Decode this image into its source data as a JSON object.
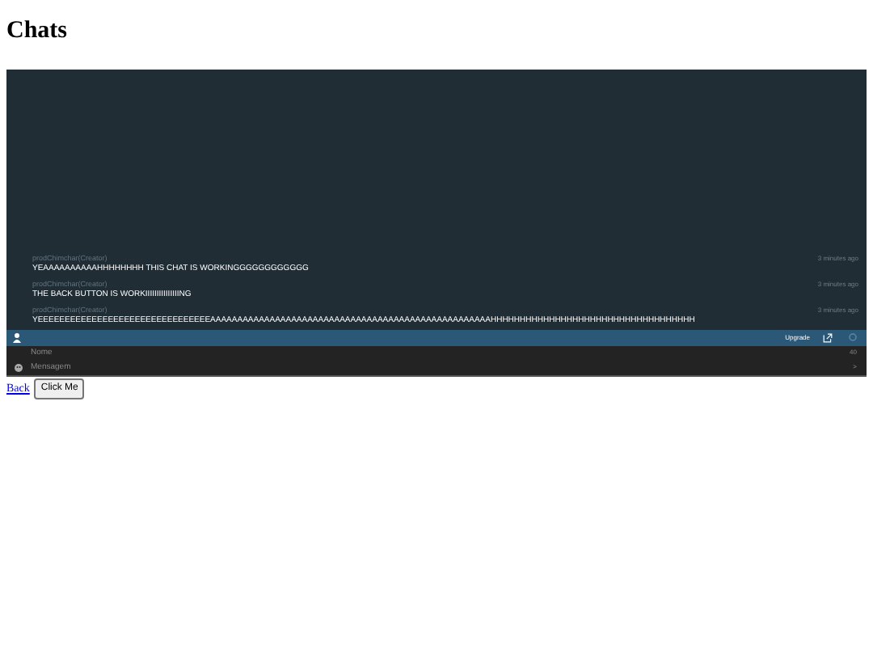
{
  "title": "Chats",
  "messages": [
    {
      "author": "prodChimchar(Creator)",
      "text": "YEAAAAAAAAAAHHHHHHHH THIS CHAT IS WORKINGGGGGGGGGGGG",
      "time": "3 minutes ago"
    },
    {
      "author": "prodChimchar(Creator)",
      "text": "THE BACK BUTTON IS WORKIIIIIIIIIIIIIIING",
      "time": "3 minutes ago"
    },
    {
      "author": "prodChimchar(Creator)",
      "text": "YEEEEEEEEEEEEEEEEEEEEEEEEEEEEEEEEAAAAAAAAAAAAAAAAAAAAAAAAAAAAAAAAAAAAAAAAAAAAAAAAAAAAHHHHHHHHHHHHHHHHHHHHHHHHHHHHHHHHHHH",
      "time": "3 minutes ago"
    }
  ],
  "toolbar": {
    "upgrade": "Upgrade"
  },
  "name_field": {
    "placeholder": "Nome",
    "counter": "40"
  },
  "message_field": {
    "placeholder": "Mensagem",
    "send": ">"
  },
  "links": {
    "back": "Back",
    "button": "Click Me"
  }
}
